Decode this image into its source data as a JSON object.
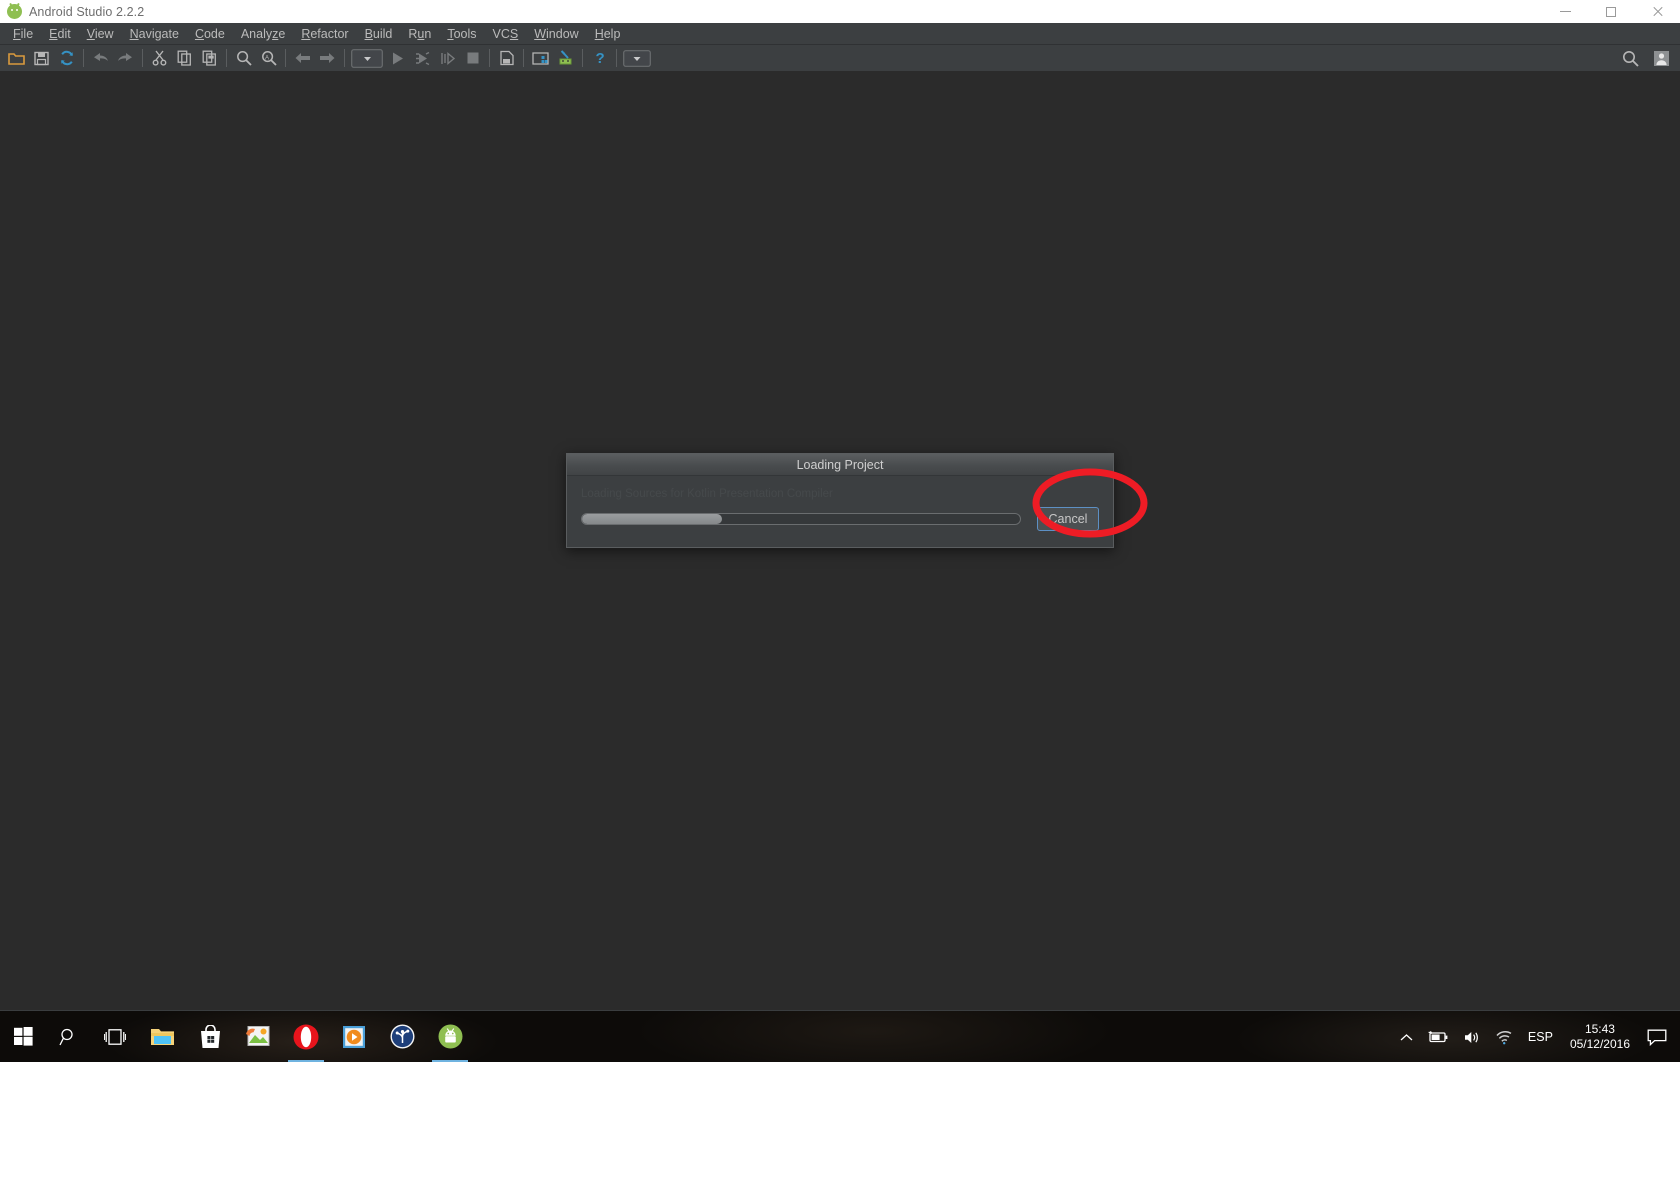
{
  "window": {
    "title": "Android Studio 2.2.2",
    "icon": "android-logo-icon",
    "controls": {
      "minimize": "minimize-icon",
      "maximize": "maximize-icon",
      "close": "close-icon"
    }
  },
  "menubar": {
    "items": [
      {
        "label": "File",
        "mnemonic": "F"
      },
      {
        "label": "Edit",
        "mnemonic": "E"
      },
      {
        "label": "View",
        "mnemonic": "V"
      },
      {
        "label": "Navigate",
        "mnemonic": "N"
      },
      {
        "label": "Code",
        "mnemonic": "C"
      },
      {
        "label": "Analyze",
        "mnemonic": "z"
      },
      {
        "label": "Refactor",
        "mnemonic": "R"
      },
      {
        "label": "Build",
        "mnemonic": "B"
      },
      {
        "label": "Run",
        "mnemonic": "u"
      },
      {
        "label": "Tools",
        "mnemonic": "T"
      },
      {
        "label": "VCS",
        "mnemonic": "S"
      },
      {
        "label": "Window",
        "mnemonic": "W"
      },
      {
        "label": "Help",
        "mnemonic": "H"
      }
    ]
  },
  "toolbar": {
    "buttons": [
      "open-folder-icon",
      "save-all-icon",
      "sync-refresh-icon",
      "undo-icon",
      "redo-icon",
      "cut-icon",
      "copy-icon",
      "paste-icon",
      "find-icon",
      "replace-icon",
      "back-navigate-icon",
      "forward-navigate-icon",
      "run-configuration-dropdown",
      "run-icon",
      "debug-icon",
      "run-with-coverage-icon",
      "stop-icon",
      "sync-project-gradle-icon",
      "avd-manager-icon",
      "sdk-manager-icon",
      "help-icon",
      "toolbar-overflow-dropdown"
    ],
    "right_buttons": [
      "search-everywhere-icon",
      "user-avatar-icon"
    ]
  },
  "dialog": {
    "title": "Loading Project",
    "status_text": "Loading Sources for Kotlin Presentation  Compiler",
    "progress_percent": 32,
    "cancel_label": "Cancel"
  },
  "annotation": {
    "shape": "ellipse-highlight",
    "color": "#ee1c25",
    "target": "cancel-button"
  },
  "taskbar": {
    "start": "windows-start-icon",
    "search": "search-icon",
    "task_view": "task-view-icon",
    "apps": [
      {
        "name": "file-explorer-icon",
        "running": false
      },
      {
        "name": "microsoft-store-icon",
        "running": false
      },
      {
        "name": "photos-icon",
        "running": false
      },
      {
        "name": "opera-browser-icon",
        "running": true
      },
      {
        "name": "media-player-icon",
        "running": false
      },
      {
        "name": "sourcetree-icon",
        "running": false
      },
      {
        "name": "android-studio-icon",
        "running": true
      }
    ],
    "tray": {
      "expand": "chevron-up-icon",
      "battery": "battery-charging-icon",
      "volume": "volume-icon",
      "network": "wifi-icon",
      "language": "ESP",
      "time": "15:43",
      "date": "05/12/2016",
      "action_center": "notification-icon"
    }
  },
  "colors": {
    "titlebar_bg": "#ffffff",
    "chrome_bg": "#3c3f41",
    "editor_bg": "#2b2b2b",
    "accent_blue": "#5d90c4",
    "annotation_red": "#ee1c25",
    "android_green": "#8fbf52"
  }
}
